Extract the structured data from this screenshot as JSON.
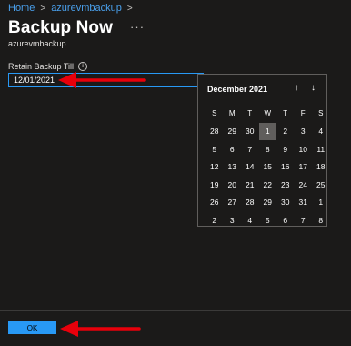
{
  "breadcrumb": {
    "home": "Home",
    "resource": "azurevmbackup",
    "separator": ">"
  },
  "header": {
    "title": "Backup Now",
    "more": "···",
    "subtitle": "azurevmbackup"
  },
  "form": {
    "label": "Retain Backup Till",
    "info": "i",
    "value": "12/01/2021"
  },
  "calendar": {
    "month_label": "December 2021",
    "nav_up": "↑",
    "nav_down": "↓",
    "weekdays": [
      "S",
      "M",
      "T",
      "W",
      "T",
      "F",
      "S"
    ],
    "weeks": [
      [
        "28",
        "29",
        "30",
        "1",
        "2",
        "3",
        "4"
      ],
      [
        "5",
        "6",
        "7",
        "8",
        "9",
        "10",
        "11"
      ],
      [
        "12",
        "13",
        "14",
        "15",
        "16",
        "17",
        "18"
      ],
      [
        "19",
        "20",
        "21",
        "22",
        "23",
        "24",
        "25"
      ],
      [
        "26",
        "27",
        "28",
        "29",
        "30",
        "31",
        "1"
      ],
      [
        "2",
        "3",
        "4",
        "5",
        "6",
        "7",
        "8"
      ]
    ],
    "selected_day": "1"
  },
  "footer": {
    "ok_label": "OK"
  },
  "colors": {
    "accent": "#2899f5",
    "link": "#4aa0ec",
    "annotation_arrow": "#e8000b",
    "selected_bg": "#605e5c"
  }
}
